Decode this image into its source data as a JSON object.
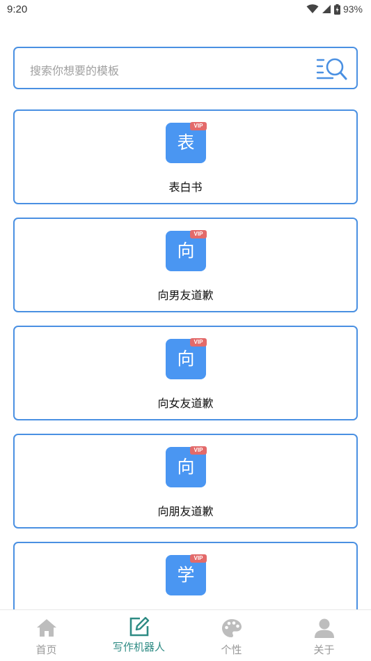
{
  "status_bar": {
    "time": "9:20",
    "battery": "93%",
    "icons": [
      "wifi-icon",
      "cellular-icon",
      "battery-icon"
    ]
  },
  "search": {
    "placeholder": "搜索你想要的模板",
    "icon": "search-list-icon"
  },
  "templates": [
    {
      "char": "表",
      "title": "表白书",
      "tag": "VIP"
    },
    {
      "char": "向",
      "title": "向男友道歉",
      "tag": "VIP"
    },
    {
      "char": "向",
      "title": "向女友道歉",
      "tag": "VIP"
    },
    {
      "char": "向",
      "title": "向朋友道歉",
      "tag": "VIP"
    },
    {
      "char": "学",
      "title": "",
      "tag": "VIP"
    }
  ],
  "bottom_nav": {
    "items": [
      {
        "label": "首页",
        "icon": "home-icon"
      },
      {
        "label": "写作机器人",
        "icon": "edit-icon",
        "active": true
      },
      {
        "label": "个性",
        "icon": "palette-icon"
      },
      {
        "label": "关于",
        "icon": "user-icon"
      }
    ]
  },
  "colors": {
    "accent_blue": "#4a90e2",
    "badge_blue": "#4a96f2",
    "vip_red": "#e36a6a",
    "nav_active": "#2e8b84",
    "nav_inactive": "#bdbdbd"
  }
}
